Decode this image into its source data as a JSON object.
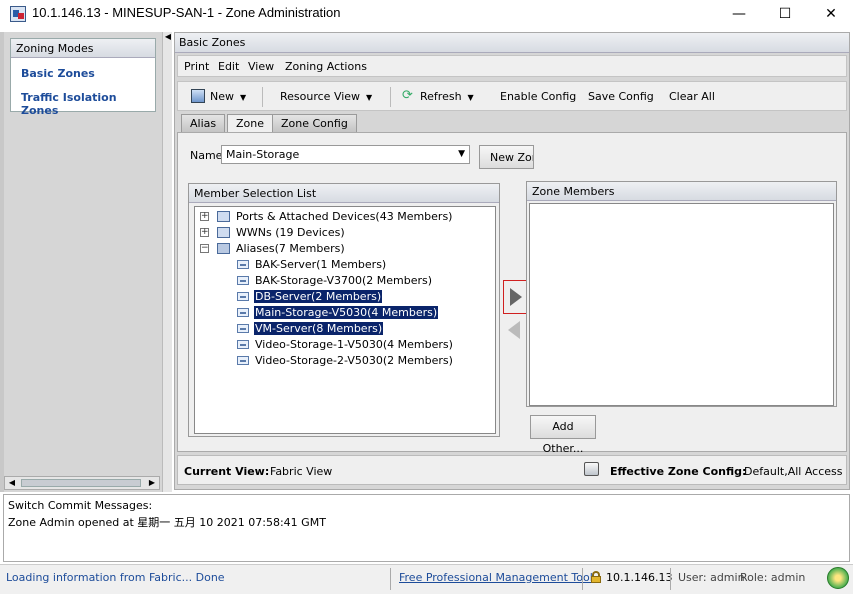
{
  "window": {
    "title": "10.1.146.13 - MINESUP-SAN-1 - Zone Administration",
    "min_glyph": "—",
    "max_glyph": "☐",
    "close_glyph": "✕"
  },
  "left_panel": {
    "header": "Zoning Modes",
    "items": [
      "Basic Zones",
      "Traffic Isolation Zones"
    ]
  },
  "right_panel": {
    "header": "Basic Zones",
    "menu": [
      "Print",
      "Edit",
      "View",
      "Zoning Actions"
    ],
    "toolbar": {
      "new": "New",
      "resource_view": "Resource View",
      "refresh": "Refresh",
      "enable_config": "Enable Config",
      "save_config": "Save Config",
      "clear_all": "Clear All"
    },
    "tabs": [
      "Alias",
      "Zone",
      "Zone Config"
    ],
    "active_tab": "Zone",
    "name_label": "Name",
    "name_value": "Main-Storage",
    "new_zone_button": "New Zone",
    "member_selection_header": "Member Selection List",
    "tree": {
      "groups": [
        {
          "label": "Ports & Attached Devices(43 Members)",
          "expander": "+",
          "icon": "ports-icon"
        },
        {
          "label": "WWNs (19 Devices)",
          "expander": "+",
          "icon": "wwn-icon"
        },
        {
          "label": "Aliases(7 Members)",
          "expander": "−",
          "icon": "alias-folder-icon"
        }
      ],
      "aliases": [
        {
          "label": "BAK-Server(1 Members)",
          "selected": false
        },
        {
          "label": "BAK-Storage-V3700(2 Members)",
          "selected": false
        },
        {
          "label": "DB-Server(2 Members)",
          "selected": true
        },
        {
          "label": "Main-Storage-V5030(4 Members)",
          "selected": true
        },
        {
          "label": "VM-Server(8 Members)",
          "selected": true
        },
        {
          "label": "Video-Storage-1-V5030(4 Members)",
          "selected": false
        },
        {
          "label": "Video-Storage-2-V5030(2 Members)",
          "selected": false
        }
      ]
    },
    "zone_members_header": "Zone Members",
    "add_other_button": "Add Other...",
    "current_view_label": "Current View:",
    "current_view_value": "Fabric View",
    "effective_zone_config_label": "Effective Zone Config:",
    "effective_zone_config_value": "Default,All Access"
  },
  "messages": {
    "label": "Switch Commit Messages:",
    "line": "Zone Admin opened at 星期一 五月 10 2021 07:58:41 GMT"
  },
  "statusbar": {
    "loading": "Loading information from Fabric... Done",
    "free_tool": "Free Professional Management Tool",
    "ip": "10.1.146.13",
    "user": "User: admin",
    "role": "Role: admin"
  },
  "colors": {
    "selection": "#0a246a",
    "link": "#1d4c9a",
    "arrow_highlight": "#d02020"
  }
}
